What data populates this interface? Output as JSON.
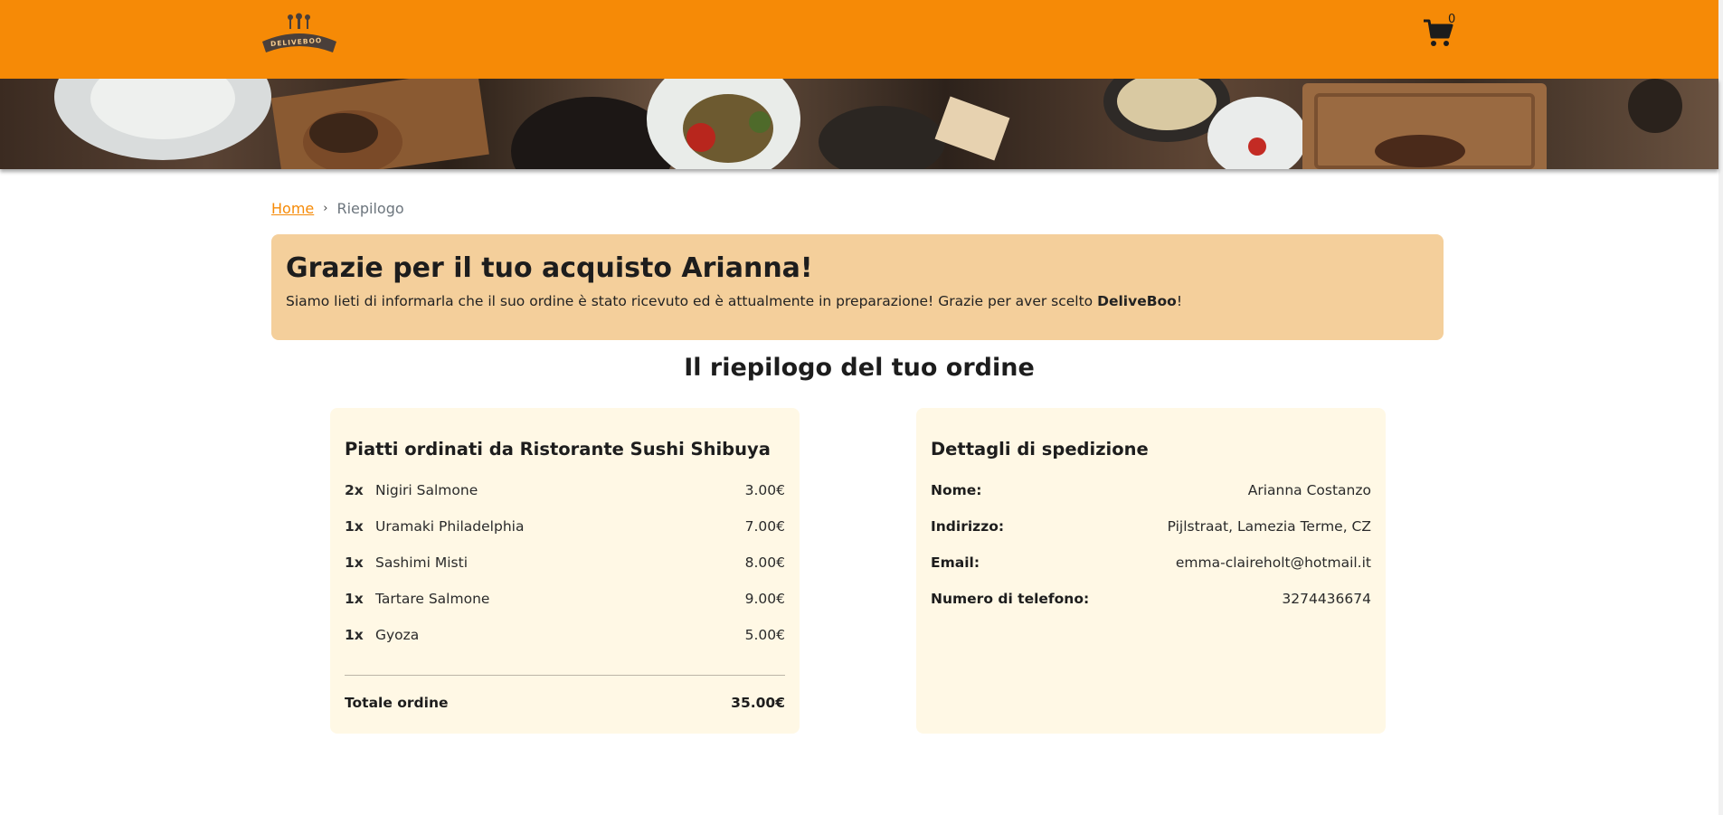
{
  "header": {
    "logo_text": "DELIVEBOO",
    "cart_count": "0",
    "cart_icon": "shopping-cart-icon",
    "accent_color": "#f68a06"
  },
  "breadcrumb": {
    "home": "Home",
    "separator": "›",
    "current": "Riepilogo"
  },
  "alert": {
    "title": "Grazie per il tuo acquisto Arianna!",
    "message": "Siamo lieti di informarla che il suo ordine è stato ricevuto ed è attualmente in preparazione! Grazie per aver scelto ",
    "brand": "DeliveBoo",
    "message_end": "!"
  },
  "summary_title": "Il riepilogo del tuo ordine",
  "order": {
    "title": "Piatti ordinati da Ristorante Sushi Shibuya",
    "items": [
      {
        "qty": "2x",
        "name": "Nigiri Salmone",
        "price": "3.00€"
      },
      {
        "qty": "1x",
        "name": "Uramaki Philadelphia",
        "price": "7.00€"
      },
      {
        "qty": "1x",
        "name": "Sashimi Misti",
        "price": "8.00€"
      },
      {
        "qty": "1x",
        "name": "Tartare Salmone",
        "price": "9.00€"
      },
      {
        "qty": "1x",
        "name": "Gyoza",
        "price": "5.00€"
      }
    ],
    "total_label": "Totale ordine",
    "total_value": "35.00€"
  },
  "shipping": {
    "title": "Dettagli di spedizione",
    "fields": [
      {
        "label": "Nome:",
        "value": "Arianna Costanzo"
      },
      {
        "label": "Indirizzo:",
        "value": "Pijlstraat, Lamezia Terme, CZ"
      },
      {
        "label": "Email:",
        "value": "emma-claireholt@hotmail.it"
      },
      {
        "label": "Numero di telefono:",
        "value": "3274436674"
      }
    ]
  }
}
